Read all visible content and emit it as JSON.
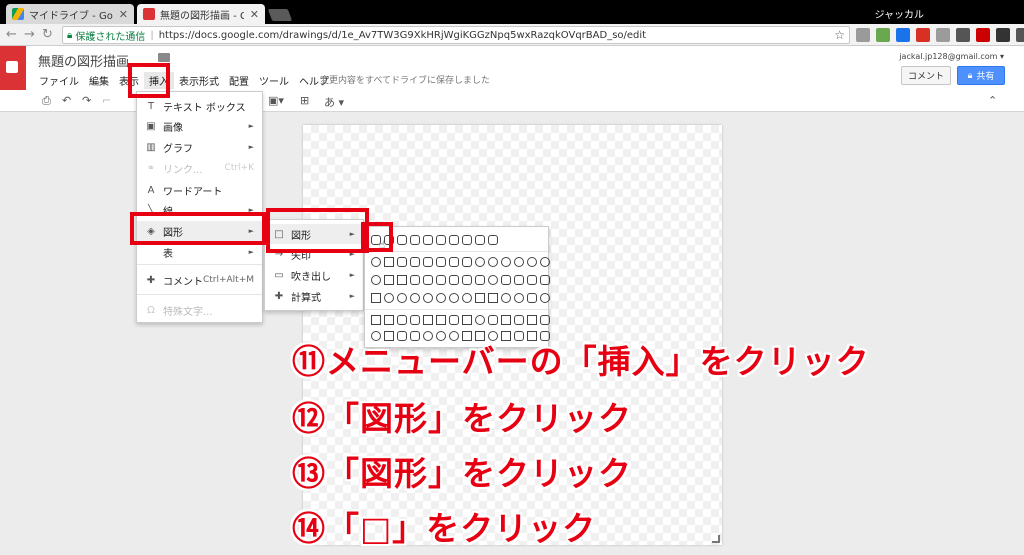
{
  "browser": {
    "tabs": [
      {
        "label": "マイドライブ - Google ドライ"
      },
      {
        "label": "無題の図形描画 - Google"
      }
    ],
    "profile_name": "ジャッカル",
    "secure_label": "保護された通信",
    "url": "https://docs.google.com/drawings/d/1e_Av7TW3G9XkHRjWgiKGGzNpq5wxRazqkOVqrBAD_so/edit",
    "extension_colors": [
      "#9a9a9a",
      "#6aa84f",
      "#1a73e8",
      "#d93025",
      "#9b9b9b",
      "#555555",
      "#cc0000",
      "#333333",
      "#555555"
    ]
  },
  "docs": {
    "title": "無題の図形描画",
    "menu": [
      "ファイル",
      "編集",
      "表示",
      "挿入",
      "表示形式",
      "配置",
      "ツール",
      "ヘルプ"
    ],
    "save_status": "変更内容をすべてドライブに保存しました",
    "account": "jackal.jp128@gmail.com ▾",
    "comment_button": "コメント",
    "share_button": "共有",
    "accent_color": "#db3236",
    "share_color": "#4d90fe"
  },
  "toolbar": {
    "text_placeholder": "あ"
  },
  "insert_menu": {
    "items": [
      {
        "icon": "text-box-icon",
        "label": "テキスト ボックス",
        "shortcut": "",
        "submenu": false,
        "disabled": false
      },
      {
        "icon": "image-icon",
        "label": "画像",
        "shortcut": "",
        "submenu": true,
        "disabled": false
      },
      {
        "icon": "chart-icon",
        "label": "グラフ",
        "shortcut": "",
        "submenu": true,
        "disabled": false
      },
      {
        "icon": "link-icon",
        "label": "リンク...",
        "shortcut": "Ctrl+K",
        "submenu": false,
        "disabled": true
      },
      {
        "icon": "wordart-icon",
        "label": "ワードアート",
        "shortcut": "",
        "submenu": false,
        "disabled": false
      },
      {
        "icon": "line-icon",
        "label": "線",
        "shortcut": "",
        "submenu": true,
        "disabled": false
      },
      {
        "icon": "shape-icon",
        "label": "図形",
        "shortcut": "",
        "submenu": true,
        "disabled": false
      },
      {
        "icon": "table-icon",
        "label": "表",
        "shortcut": "",
        "submenu": true,
        "disabled": false
      },
      {
        "icon": "comment-icon",
        "label": "コメント",
        "shortcut": "Ctrl+Alt+M",
        "submenu": false,
        "disabled": false
      },
      {
        "icon": "special-chars-icon",
        "label": "特殊文字...",
        "shortcut": "",
        "submenu": false,
        "disabled": true
      }
    ]
  },
  "shape_submenu": {
    "items": [
      {
        "icon": "square-icon",
        "label": "図形"
      },
      {
        "icon": "arrow-icon",
        "label": "矢印"
      },
      {
        "icon": "callout-icon",
        "label": "吹き出し"
      },
      {
        "icon": "plus-icon",
        "label": "計算式"
      }
    ]
  },
  "annotations": [
    "⑪メニューバーの「挿入」をクリック",
    "⑫「図形」をクリック",
    "⑬「図形」をクリック",
    "⑭「□」をクリック"
  ],
  "highlight_color": "#e60012"
}
